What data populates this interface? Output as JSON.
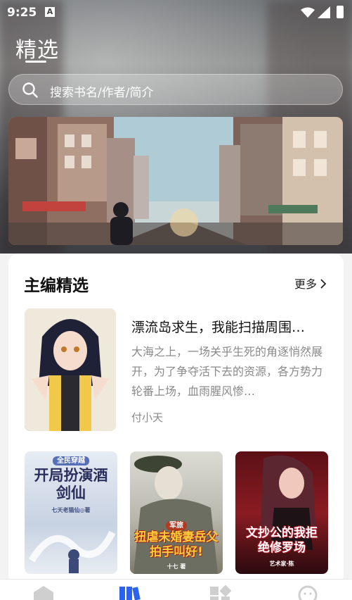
{
  "status_bar": {
    "time": "9:25"
  },
  "header": {
    "title": "精选"
  },
  "search": {
    "placeholder": "搜索书名/作者/简介"
  },
  "section": {
    "title": "主编精选",
    "more_label": "更多"
  },
  "featured_book": {
    "title": "漂流岛求生，我能扫描周围…",
    "description": "大海之上，一场关乎生死的角逐悄然展开，为了争夺活下去的资源，各方势力轮番上场，血雨腥风惨…",
    "author": "付小天"
  },
  "books": [
    {
      "cover_text_top": "全民穿越",
      "cover_text": "开局扮演酒剑仙",
      "cover_text_small": "七天老猫仙◎著"
    },
    {
      "cover_text_top": "军旅",
      "cover_text": "扭虐未婚妻岳父拍手叫好!",
      "cover_text_small": "十七 著"
    },
    {
      "cover_text": "文抄公的我拒绝修罗场",
      "cover_text_small": "艺术家·陈"
    }
  ],
  "bottom_nav": {
    "items": [
      "home-icon",
      "library-icon",
      "category-icon",
      "profile-icon"
    ]
  },
  "colors": {
    "accent": "#2b62f0",
    "text_primary": "#111111",
    "text_secondary": "#8a8a8a"
  }
}
